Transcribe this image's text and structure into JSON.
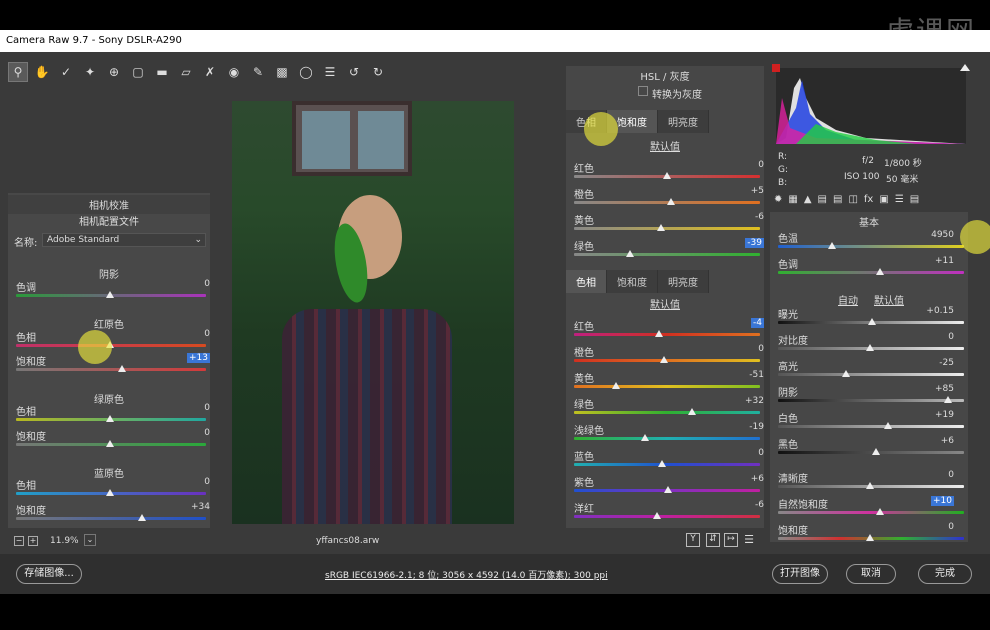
{
  "window": {
    "title": "Camera Raw 9.7 -  Sony DSLR-A290"
  },
  "watermark": "虎课网",
  "toolbar": [
    "zoom-tool-icon",
    "hand-tool-icon",
    "white-balance-icon",
    "color-sampler-icon",
    "target-adjust-icon",
    "crop-icon",
    "straighten-icon",
    "transform-icon",
    "spot-removal-icon",
    "red-eye-icon",
    "adjustment-brush-icon",
    "graduated-filter-icon",
    "radial-filter-icon",
    "list-icon",
    "rotate-left-icon",
    "rotate-right-icon"
  ],
  "left_panel": {
    "section_title": "相机校准",
    "profile_title": "相机配置文件",
    "name_label": "名称:",
    "name_value": "Adobe Standard",
    "shadows": {
      "title": "阴影",
      "rows": [
        {
          "label": "色调",
          "value": "0"
        }
      ]
    },
    "red": {
      "title": "红原色",
      "rows": [
        {
          "label": "色相",
          "value": "0"
        },
        {
          "label": "饱和度",
          "value": "+13"
        }
      ]
    },
    "green": {
      "title": "绿原色",
      "rows": [
        {
          "label": "色相",
          "value": "0"
        },
        {
          "label": "饱和度",
          "value": "0"
        }
      ]
    },
    "blue": {
      "title": "蓝原色",
      "rows": [
        {
          "label": "色相",
          "value": "0"
        },
        {
          "label": "饱和度",
          "value": "+34"
        }
      ]
    }
  },
  "status": {
    "zoom": "11.9%",
    "filename": "yffancs08.arw",
    "info": "sRGB IEC61966-2.1; 8 位; 3056 x 4592 (14.0 百万像素); 300 ppi"
  },
  "hsl_top": {
    "header": "HSL / 灰度",
    "grayscale": "转换为灰度",
    "tabs": [
      "色相",
      "饱和度",
      "明亮度"
    ],
    "default": "默认值",
    "rows": [
      {
        "label": "红色",
        "value": "0"
      },
      {
        "label": "橙色",
        "value": "+5"
      },
      {
        "label": "黄色",
        "value": "-6"
      },
      {
        "label": "绿色",
        "value": "-39"
      }
    ]
  },
  "hsl_bottom": {
    "tabs": [
      "色相",
      "饱和度",
      "明亮度"
    ],
    "default": "默认值",
    "rows": [
      {
        "label": "红色",
        "value": "-4"
      },
      {
        "label": "橙色",
        "value": "0"
      },
      {
        "label": "黄色",
        "value": "-51"
      },
      {
        "label": "绿色",
        "value": "+32"
      },
      {
        "label": "浅绿色",
        "value": "-19"
      },
      {
        "label": "蓝色",
        "value": "0"
      },
      {
        "label": "紫色",
        "value": "+6"
      },
      {
        "label": "洋红",
        "value": "-6"
      }
    ]
  },
  "histogram": {
    "r": "R:",
    "g": "G:",
    "b": "B:",
    "aperture": "f/2",
    "shutter": "1/800 秒",
    "iso": "ISO 100",
    "focal": "50 毫米"
  },
  "basic": {
    "title": "基本",
    "temp": {
      "label": "色温",
      "value": "4950"
    },
    "tint": {
      "label": "色调",
      "value": "+11"
    },
    "auto": "自动",
    "default": "默认值",
    "rows": [
      {
        "label": "曝光",
        "value": "+0.15"
      },
      {
        "label": "对比度",
        "value": "0"
      },
      {
        "label": "高光",
        "value": "-25"
      },
      {
        "label": "阴影",
        "value": "+85"
      },
      {
        "label": "白色",
        "value": "+19"
      },
      {
        "label": "黑色",
        "value": "+6"
      }
    ],
    "presence": [
      {
        "label": "清晰度",
        "value": "0"
      },
      {
        "label": "自然饱和度",
        "value": "+10"
      },
      {
        "label": "饱和度",
        "value": "0"
      }
    ]
  },
  "buttons": {
    "save": "存储图像...",
    "open": "打开图像",
    "cancel": "取消",
    "done": "完成"
  }
}
